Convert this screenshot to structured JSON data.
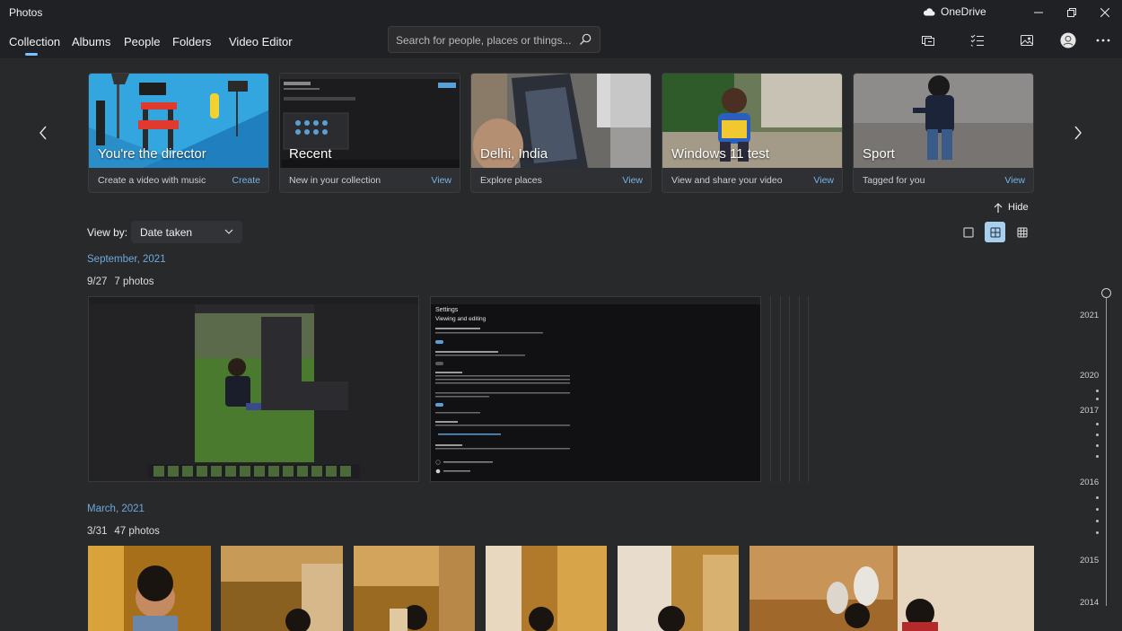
{
  "window": {
    "app_title": "Photos",
    "onedrive_label": "OneDrive"
  },
  "nav": {
    "tabs": [
      {
        "label": "Collection",
        "active": true
      },
      {
        "label": "Albums"
      },
      {
        "label": "People"
      },
      {
        "label": "Folders"
      },
      {
        "label": "Video Editor"
      }
    ]
  },
  "search": {
    "placeholder": "Search for people, places or things..."
  },
  "cards": [
    {
      "title": "You're the director",
      "subtitle": "Create a video with music",
      "action": "Create"
    },
    {
      "title": "Recent",
      "subtitle": "New in your collection",
      "action": "View"
    },
    {
      "title": "Delhi, India",
      "subtitle": "Explore places",
      "action": "View"
    },
    {
      "title": "Windows 11 test",
      "subtitle": "View and share your video",
      "action": "View"
    },
    {
      "title": "Sport",
      "subtitle": "Tagged for you",
      "action": "View"
    }
  ],
  "hide_label": "Hide",
  "view_by": {
    "label": "View by:",
    "value": "Date taken"
  },
  "groups": [
    {
      "month": "September, 2021",
      "date": "9/27",
      "count": "7 photos"
    },
    {
      "month": "March, 2021",
      "date": "3/31",
      "count": "47 photos"
    }
  ],
  "screenshot_thumbs": {
    "settings_title": "Settings",
    "settings_heading": "Viewing and editing"
  },
  "timeline": {
    "years": [
      "2021",
      "2020",
      "2017",
      "2016",
      "2015",
      "2014"
    ]
  },
  "colors": {
    "accent": "#78c3ff",
    "link": "#6fa8dc",
    "active_view_mode": "#a9cfee"
  }
}
